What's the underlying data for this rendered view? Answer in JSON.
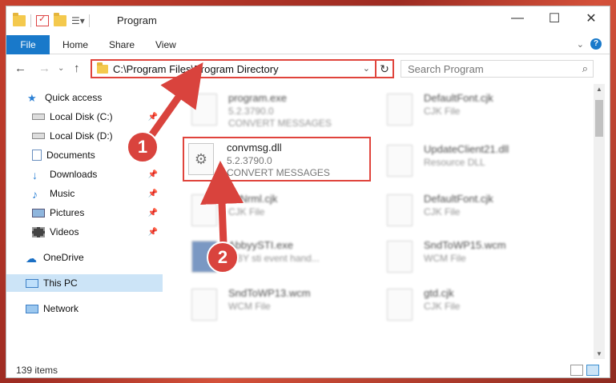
{
  "window": {
    "title": "Program"
  },
  "ribbon": {
    "tabs": [
      "File",
      "Home",
      "Share",
      "View"
    ]
  },
  "address": {
    "path": "C:\\Program Files\\Program Directory"
  },
  "search": {
    "placeholder": "Search Program"
  },
  "sidebar": {
    "items": [
      {
        "label": "Quick access",
        "icon": "star-icon"
      },
      {
        "label": "Local Disk (C:)",
        "icon": "drive-icon",
        "pinned": true
      },
      {
        "label": "Local Disk (D:)",
        "icon": "drive-icon",
        "pinned": false
      },
      {
        "label": "Documents",
        "icon": "documents-icon",
        "pinned": true
      },
      {
        "label": "Downloads",
        "icon": "download-icon",
        "pinned": true
      },
      {
        "label": "Music",
        "icon": "music-icon",
        "pinned": true
      },
      {
        "label": "Pictures",
        "icon": "pictures-icon",
        "pinned": true
      },
      {
        "label": "Videos",
        "icon": "videos-icon",
        "pinned": true
      },
      {
        "label": "OneDrive",
        "icon": "cloud-icon"
      },
      {
        "label": "This PC",
        "icon": "computer-icon",
        "selected": true
      },
      {
        "label": "Network",
        "icon": "network-icon"
      }
    ]
  },
  "files": [
    {
      "name": "program.exe",
      "line2": "5.2.3790.0",
      "line3": "CONVERT MESSAGES"
    },
    {
      "name": "DefaultFont.cjk",
      "line2": "CJK File",
      "line3": ""
    },
    {
      "name": "convmsg.dll",
      "line2": "5.2.3790.0",
      "line3": "CONVERT MESSAGES"
    },
    {
      "name": "UpdateClient21.dll",
      "line2": "Resource DLL",
      "line3": ""
    },
    {
      "name": "...tNrml.cjk",
      "line2": "CJK File",
      "line3": ""
    },
    {
      "name": "DefaultFont.cjk",
      "line2": "CJK File",
      "line3": ""
    },
    {
      "name": "AbbyySTI.exe",
      "line2": "...BY sti event hand...",
      "line3": ""
    },
    {
      "name": "SndToWP15.wcm",
      "line2": "WCM File",
      "line3": ""
    },
    {
      "name": "SndToWP13.wcm",
      "line2": "WCM File",
      "line3": ""
    },
    {
      "name": "gtd.cjk",
      "line2": "CJK File",
      "line3": ""
    }
  ],
  "status": {
    "count": "139 items"
  },
  "annotations": {
    "step1": "1",
    "step2": "2"
  },
  "colors": {
    "accent": "#1979ca",
    "highlight": "#e0443c"
  }
}
